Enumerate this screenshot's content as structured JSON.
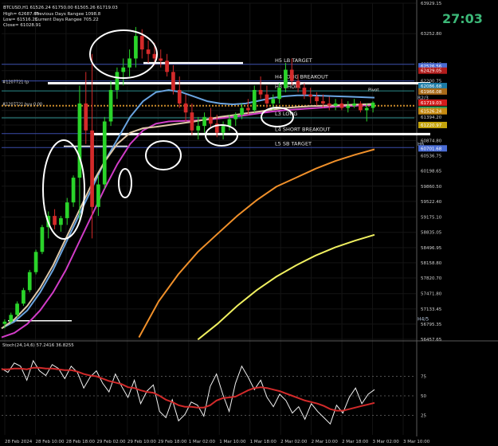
{
  "header": {
    "symbol_line": "BTCUSD,H1  61526.24 61750.00 61505.26 61719.03",
    "stats": [
      {
        "label": "High= 62687.65",
        "value": "Previous Days Rangee 1098.8"
      },
      {
        "label": "Low= 61516.25",
        "value": "Current Days Rangee 705.22"
      },
      {
        "label": "Close= 61028.91",
        "value": ""
      }
    ],
    "timer": "27:03"
  },
  "chart_data": {
    "type": "candlestick",
    "instrument": "BTCUSD",
    "timeframe": "H1",
    "ylim": [
      56457.65,
      63929.15
    ],
    "price_ticks": [
      "63929.15",
      "63252.80",
      "62576.45",
      "62429.05",
      "62200.75",
      "61542.35",
      "61394.20",
      "61220.97",
      "60874.80",
      "60536.75",
      "60198.65",
      "59860.50",
      "59522.40",
      "59175.10",
      "58835.05",
      "58496.95",
      "58158.80",
      "57820.70",
      "57471.80",
      "57133.45",
      "56795.35",
      "56457.65"
    ],
    "price_tags": [
      {
        "text": "62526.56",
        "price": 62526.56,
        "color": "#4a6cd4"
      },
      {
        "text": "62429.05",
        "price": 62429.05,
        "color": "#b21c1c"
      },
      {
        "text": "62086.68",
        "price": 62086.68,
        "color": "#1c7ca6"
      },
      {
        "text": "61966.08",
        "price": 61966.08,
        "color": "#a86a1a"
      },
      {
        "text": "61719.03",
        "price": 61719.03,
        "color": "#d41c1c"
      },
      {
        "text": "61562.64",
        "price": 61562.64,
        "color": "#2a9c5a"
      },
      {
        "text": "61526.24",
        "price": 61526.24,
        "color": "#c68a12"
      },
      {
        "text": "61220.97",
        "price": 61220.97,
        "color": "#c4a40c"
      },
      {
        "text": "60701.68",
        "price": 60701.68,
        "color": "#4a6cd4"
      }
    ],
    "time_ticks": [
      "28 Feb 2024",
      "28 Feb 10:00",
      "28 Feb 18:00",
      "29 Feb 02:00",
      "29 Feb 10:00",
      "29 Feb 18:00",
      "1 Mar 02:00",
      "1 Mar 10:00",
      "1 Mar 18:00",
      "2 Mar 02:00",
      "2 Mar 10:00",
      "2 Mar 18:00",
      "3 Mar 02:00",
      "3 Mar 10:00"
    ],
    "levels": [
      {
        "label": "H5 LB TARGET",
        "price": 62570,
        "color": "#3a4caa"
      },
      {
        "label": "H4 LONG BREAKOUT",
        "price": 62200,
        "color": "#3a4caa"
      },
      {
        "label": "H3 SHORT",
        "price": 61980,
        "color": "#2a8c8c"
      },
      {
        "label": "L3 LONG",
        "price": 61380,
        "color": "#2a8c8c"
      },
      {
        "label": "L4 SHORT BREAKOUT",
        "price": 61030,
        "color": "#3a4caa"
      },
      {
        "label": "L5 SB TARGET",
        "price": 60720,
        "color": "#3a4caa"
      }
    ],
    "pivot_label": "Pivot",
    "left_labels": [
      "#1207721 tp",
      "#1207721 buy 0.00"
    ],
    "right_markers": [
      "R2/3",
      "H6",
      "H4/5"
    ],
    "candles": [
      [
        56800,
        56900,
        56700,
        56850
      ],
      [
        56850,
        57050,
        56800,
        57000
      ],
      [
        57000,
        57300,
        56950,
        57250
      ],
      [
        57250,
        57600,
        57200,
        57550
      ],
      [
        57550,
        58000,
        57500,
        57950
      ],
      [
        57950,
        58450,
        57900,
        58400
      ],
      [
        58400,
        59000,
        58350,
        58950
      ],
      [
        58950,
        59300,
        58700,
        59200
      ],
      [
        59200,
        59350,
        58900,
        59000
      ],
      [
        59000,
        59200,
        58850,
        59150
      ],
      [
        59150,
        59600,
        59000,
        59500
      ],
      [
        59500,
        60100,
        59400,
        60050
      ],
      [
        60050,
        62100,
        59100,
        61700
      ],
      [
        61700,
        62400,
        60800,
        61100
      ],
      [
        61100,
        62800,
        58700,
        59400
      ],
      [
        59400,
        60100,
        59200,
        59900
      ],
      [
        59900,
        61400,
        59800,
        61300
      ],
      [
        61300,
        62200,
        61200,
        62000
      ],
      [
        62000,
        62500,
        61800,
        62400
      ],
      [
        62400,
        62700,
        62100,
        62500
      ],
      [
        62500,
        62900,
        62300,
        62700
      ],
      [
        62700,
        63400,
        62500,
        63200
      ],
      [
        63200,
        63350,
        62700,
        62900
      ],
      [
        62900,
        63100,
        62600,
        62800
      ],
      [
        62800,
        63050,
        62550,
        62700
      ],
      [
        62700,
        62900,
        62500,
        62650
      ],
      [
        62650,
        62800,
        62300,
        62400
      ],
      [
        62400,
        62550,
        61900,
        62000
      ],
      [
        62000,
        62300,
        61600,
        61700
      ],
      [
        61700,
        61900,
        61300,
        61500
      ],
      [
        61500,
        61700,
        61000,
        61100
      ],
      [
        61100,
        61400,
        60900,
        61200
      ],
      [
        61200,
        61500,
        61050,
        61400
      ],
      [
        61400,
        61600,
        61150,
        61250
      ],
      [
        61250,
        61450,
        60950,
        61050
      ],
      [
        61050,
        61300,
        60900,
        61200
      ],
      [
        61200,
        61450,
        61100,
        61350
      ],
      [
        61350,
        61500,
        61200,
        61450
      ],
      [
        61450,
        61700,
        61350,
        61600
      ],
      [
        61600,
        61800,
        61450,
        61550
      ],
      [
        61550,
        62100,
        61500,
        62000
      ],
      [
        62000,
        62300,
        61800,
        61900
      ],
      [
        61900,
        62100,
        61600,
        61700
      ],
      [
        61700,
        61900,
        61550,
        61800
      ],
      [
        61800,
        62150,
        61700,
        62050
      ],
      [
        62050,
        62600,
        61950,
        62450
      ],
      [
        62450,
        62700,
        62100,
        62200
      ],
      [
        62200,
        62350,
        61950,
        62050
      ],
      [
        62050,
        62150,
        61800,
        61900
      ],
      [
        61900,
        62050,
        61700,
        61850
      ],
      [
        61850,
        61950,
        61650,
        61750
      ],
      [
        61750,
        61900,
        61600,
        61700
      ],
      [
        61700,
        61850,
        61550,
        61650
      ],
      [
        61650,
        61800,
        61550,
        61700
      ],
      [
        61700,
        61800,
        61550,
        61600
      ],
      [
        61600,
        61750,
        61500,
        61650
      ],
      [
        61650,
        61800,
        61600,
        61700
      ],
      [
        61700,
        61750,
        61500,
        61550
      ],
      [
        61550,
        61700,
        61300,
        61600
      ],
      [
        61600,
        61750,
        61500,
        61719
      ]
    ],
    "moving_averages": [
      {
        "color": "#6aa4e0",
        "values": [
          56700,
          56850,
          57100,
          57500,
          58000,
          58600,
          59200,
          59800,
          60400,
          60900,
          61400,
          61750,
          61950,
          62000,
          61950,
          61850,
          61750,
          61700,
          61680,
          61700,
          61760,
          61820,
          61860,
          61880,
          61880,
          61870,
          61860,
          61850,
          61840,
          61830
        ]
      },
      {
        "color": "#d23cc8",
        "values": [
          56500,
          56600,
          56800,
          57100,
          57500,
          58000,
          58600,
          59200,
          59800,
          60350,
          60800,
          61100,
          61250,
          61300,
          61310,
          61320,
          61340,
          61370,
          61400,
          61440,
          61480,
          61520,
          61550,
          61570,
          61590,
          61610,
          61630,
          61645,
          61655,
          61665
        ]
      },
      {
        "color": "#e0c8a8",
        "values": [
          56700,
          56900,
          57200,
          57600,
          58100,
          58700,
          59300,
          59900,
          60400,
          60800,
          61050,
          61150,
          61180,
          61220,
          61260,
          61300,
          61350,
          61400,
          61440,
          61480,
          61520,
          61560,
          61600,
          61620,
          61640,
          61650,
          61660,
          61670,
          61680,
          61690
        ]
      },
      {
        "color": "#f0902a",
        "values": [
          null,
          null,
          null,
          null,
          null,
          null,
          null,
          56500,
          57300,
          57900,
          58400,
          58800,
          59200,
          59550,
          59850,
          60050,
          60250,
          60420,
          60560,
          60680
        ]
      },
      {
        "color": "#f0f060",
        "values": [
          null,
          null,
          null,
          null,
          null,
          null,
          null,
          null,
          null,
          null,
          56450,
          56800,
          57200,
          57550,
          57850,
          58100,
          58320,
          58500,
          58650,
          58780
        ]
      }
    ],
    "oscillator": {
      "label": "Stoch(24,14,6) 57.2416 36.8255",
      "ylim": [
        0,
        100
      ],
      "levels": [
        75,
        50,
        25
      ],
      "main": [
        85,
        80,
        92,
        88,
        70,
        95,
        82,
        76,
        90,
        85,
        72,
        88,
        80,
        60,
        74,
        82,
        66,
        55,
        78,
        62,
        48,
        70,
        40,
        56,
        64,
        30,
        22,
        45,
        18,
        26,
        42,
        38,
        24,
        62,
        78,
        52,
        30,
        66,
        88,
        74,
        58,
        70,
        48,
        36,
        52,
        44,
        28,
        36,
        20,
        40,
        30,
        22,
        14,
        38,
        28,
        48,
        60,
        40,
        52,
        58
      ],
      "signal": [
        84,
        84,
        85,
        85,
        84,
        86,
        86,
        85,
        85,
        84,
        83,
        83,
        81,
        78,
        76,
        75,
        72,
        69,
        67,
        65,
        61,
        60,
        57,
        55,
        54,
        50,
        45,
        42,
        38,
        36,
        36,
        35,
        35,
        38,
        44,
        47,
        48,
        49,
        53,
        57,
        60,
        61,
        60,
        58,
        56,
        53,
        50,
        47,
        44,
        42,
        40,
        37,
        33,
        31,
        31,
        33,
        35,
        37,
        39,
        41
      ]
    },
    "annotations": [
      {
        "type": "ellipse",
        "shape": "pin_top"
      },
      {
        "type": "ellipse",
        "shape": "pin_left_long"
      },
      {
        "type": "ellipse",
        "shape": "pin_left_small"
      },
      {
        "type": "ellipse",
        "shape": "pin_bottom_a"
      },
      {
        "type": "ellipse",
        "shape": "pin_bottom_b"
      },
      {
        "type": "ellipse",
        "shape": "pin_mid"
      }
    ]
  }
}
